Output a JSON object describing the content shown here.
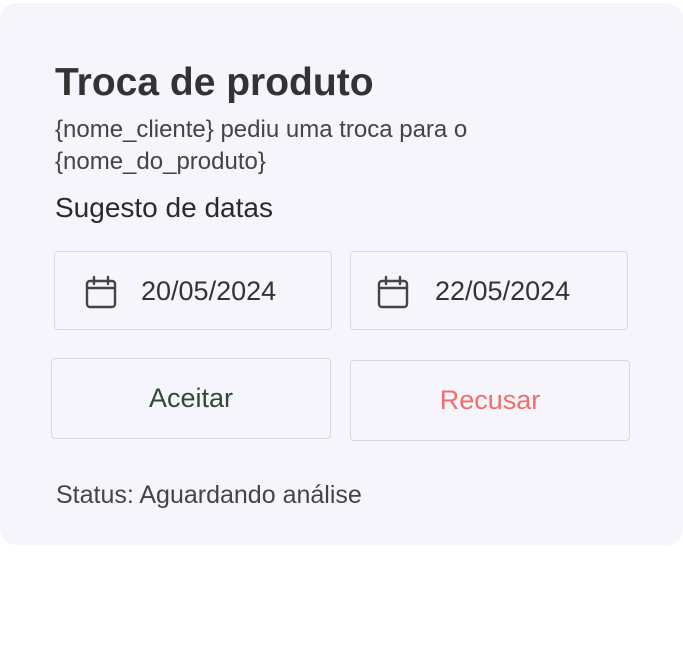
{
  "card": {
    "title": "Troca de produto",
    "subtitle": "{nome_cliente} pediu uma troca para o {nome_do_produto}",
    "dates_label": "Sugesto de datas",
    "dates": [
      {
        "icon": "calendar-icon",
        "value": "20/05/2024"
      },
      {
        "icon": "calendar-icon",
        "value": "22/05/2024"
      }
    ],
    "accept_label": "Aceitar",
    "reject_label": "Recusar",
    "status": "Status: Aguardando análise"
  },
  "colors": {
    "card_background": "#f6f5fb",
    "accept_text": "#2e4a33",
    "reject_text": "#f26d6d",
    "border": "#d8d8de"
  }
}
